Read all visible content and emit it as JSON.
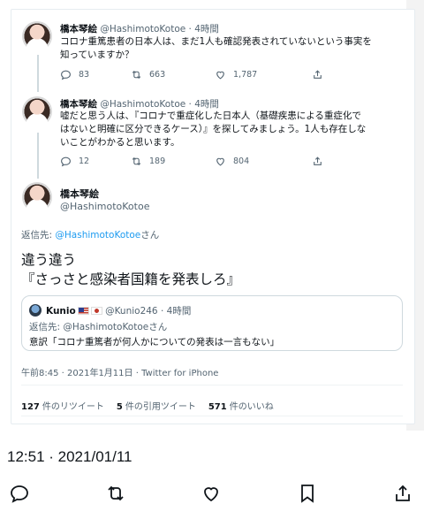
{
  "tweets": [
    {
      "name": "橋本琴絵",
      "handle": "@HashimotoKotoe",
      "time": "· 4時間",
      "text_lines": [
        "コロナ重篤患者の日本人は、まだ1人も確認発表されていないという事実を",
        "知っていますか？"
      ],
      "replies": "83",
      "retweets": "663",
      "likes": "1,787"
    },
    {
      "name": "橋本琴絵",
      "handle": "@HashimotoKotoe",
      "time": "· 4時間",
      "text_lines": [
        "嘘だと思う人は、『コロナで重症化した日本人（基礎疾患による重症化で",
        "はないと明確に区分できるケース）』を探してみましょう。1人も存在しな",
        "いことがわかると思います。"
      ],
      "replies": "12",
      "retweets": "189",
      "likes": "804"
    }
  ],
  "focus": {
    "name": "橋本琴絵",
    "handle": "@HashimotoKotoe",
    "reply_prefix": "返信先: ",
    "reply_handle": "@HashimotoKotoe",
    "reply_suffix": "さん",
    "text_line1": "違う違う",
    "text_line2": "『さっさと感染者国籍を発表しろ』",
    "timestamp": "午前8:45 · 2021年1月11日 · Twitter for iPhone",
    "retweets_num": "127",
    "retweets_label": "件のリツイート",
    "quotes_num": "5",
    "quotes_label": "件の引用ツイート",
    "likes_num": "571",
    "likes_label": "件のいいね"
  },
  "quote": {
    "name": "Kunio",
    "handle": "@Kunio246",
    "time": "· 4時間",
    "reply": "返信先: @HashimotoKotoeさん",
    "text": "意訳「コロナ重篤者が何人かについての発表は一言もない」"
  },
  "status_time": "12:51 · 2021/01/11",
  "icons": [
    "reply-icon",
    "retweet-icon",
    "like-icon",
    "share-icon",
    "bookmark-icon"
  ],
  "colors": {
    "accent": "#1d9bf0",
    "muted": "#536471"
  }
}
